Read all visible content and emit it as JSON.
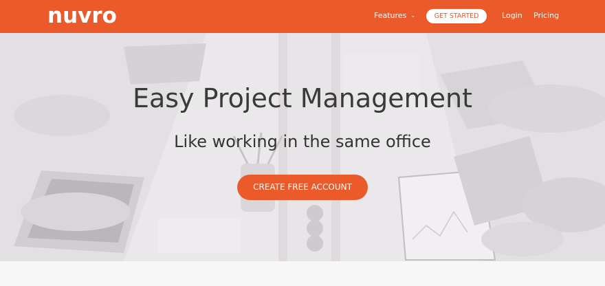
{
  "brand": {
    "logo_text": "nuvro",
    "color": "#ea5a2b"
  },
  "nav": {
    "features_label": "Features",
    "features_icon": "chevron-down-icon",
    "get_started_label": "GET STARTED",
    "login_label": "Login",
    "pricing_label": "Pricing"
  },
  "hero": {
    "title": "Easy Project Management",
    "subtitle": "Like working in the same office",
    "cta_label": "CREATE FREE ACCOUNT"
  }
}
